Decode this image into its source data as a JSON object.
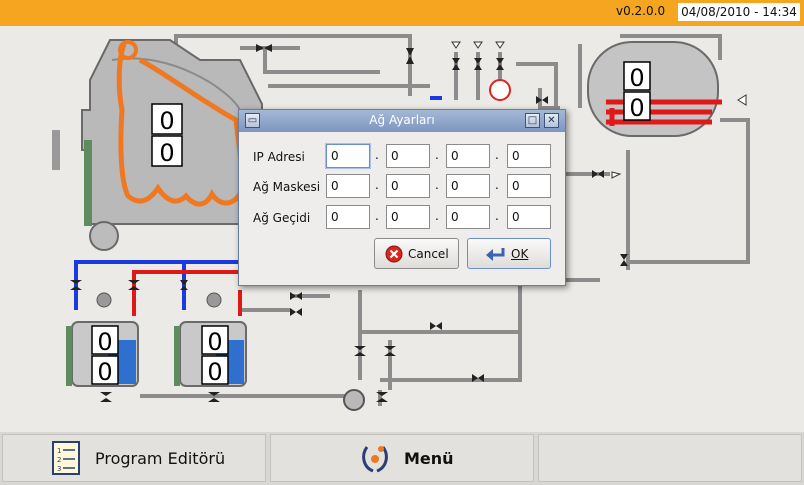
{
  "topbar": {
    "version": "v0.2.0.0",
    "datetime": "04/08/2010 - 14:34",
    "accent": "#f5a51f"
  },
  "gauges": {
    "reactor": [
      "0",
      "0"
    ],
    "heater_tank": [
      "0",
      "0"
    ],
    "tank_left": [
      "0",
      "0"
    ],
    "tank_right": [
      "0",
      "0"
    ]
  },
  "dialog": {
    "title": "Ağ Ayarları",
    "rows": [
      {
        "label": "IP Adresi",
        "octets": [
          "0",
          "0",
          "0",
          "0"
        ]
      },
      {
        "label": "Ağ Maskesi",
        "octets": [
          "0",
          "0",
          "0",
          "0"
        ]
      },
      {
        "label": "Ağ Geçidi",
        "octets": [
          "0",
          "0",
          "0",
          "0"
        ]
      }
    ],
    "separator": ".",
    "cancel_label": "Cancel",
    "ok_label": "OK"
  },
  "bottom_nav": {
    "program_editor_label": "Program Editörü",
    "menu_label": "Menü"
  }
}
